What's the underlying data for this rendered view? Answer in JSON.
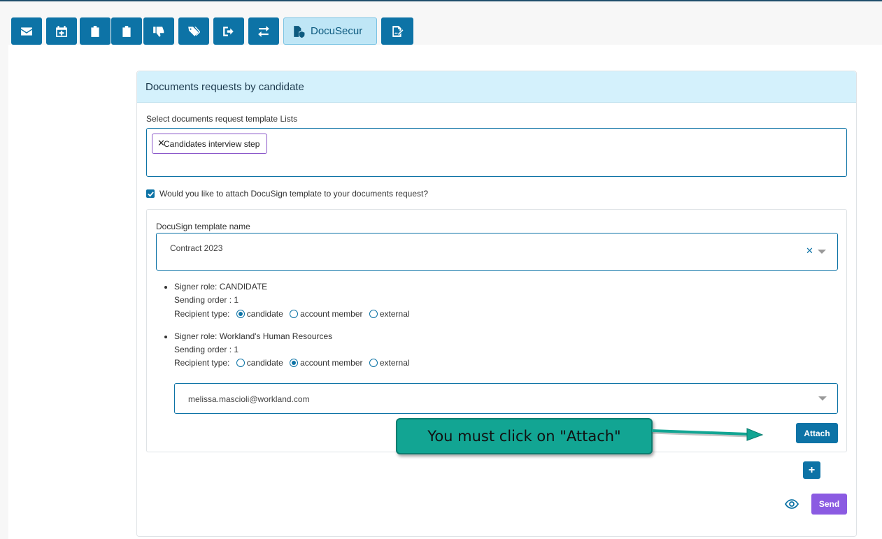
{
  "toolbar": {
    "buttons": [
      {
        "icon": "envelope-icon"
      },
      {
        "icon": "calendar-plus-icon"
      },
      {
        "icon": "clipboard-check-icon"
      },
      {
        "icon": "clipboard-question-icon"
      },
      {
        "icon": "thumbs-down-icon"
      },
      {
        "icon": "tags-icon"
      },
      {
        "icon": "sign-out-icon"
      },
      {
        "icon": "exchange-icon"
      },
      {
        "icon": "file-shield-icon",
        "label": "DocuSecur",
        "active": true
      },
      {
        "icon": "signature-icon"
      }
    ]
  },
  "card": {
    "title": "Documents requests by candidate",
    "template_list_label": "Select documents request template Lists",
    "selected_templates": [
      "Candidates interview step"
    ],
    "attach_docusign_question": "Would you like to attach DocuSign template to your documents request?",
    "attach_docusign_checked": true
  },
  "docusign": {
    "template_name_label": "DocuSign template name",
    "template_name_value": "Contract 2023",
    "signers": [
      {
        "role": "Signer role: CANDIDATE",
        "order": "Sending order : 1",
        "recipient_label": "Recipient type:",
        "options": [
          "candidate",
          "account member",
          "external"
        ],
        "selected": "candidate"
      },
      {
        "role": "Signer role: Workland's Human Resources",
        "order": "Sending order : 1",
        "recipient_label": "Recipient type:",
        "options": [
          "candidate",
          "account member",
          "external"
        ],
        "selected": "account member"
      }
    ],
    "member_select_value": "melissa.mascioli@workland.com",
    "attach_label": "Attach"
  },
  "actions": {
    "add_label": "+",
    "send_label": "Send",
    "preview_icon": "eye-icon"
  },
  "callout": {
    "text": "You must click on \"Attach\""
  },
  "colors": {
    "primary": "#0d73a6",
    "header_bg": "#d4f1fc",
    "send": "#8b5be2",
    "callout": "#12a593",
    "chip_border": "#8a56c9"
  }
}
